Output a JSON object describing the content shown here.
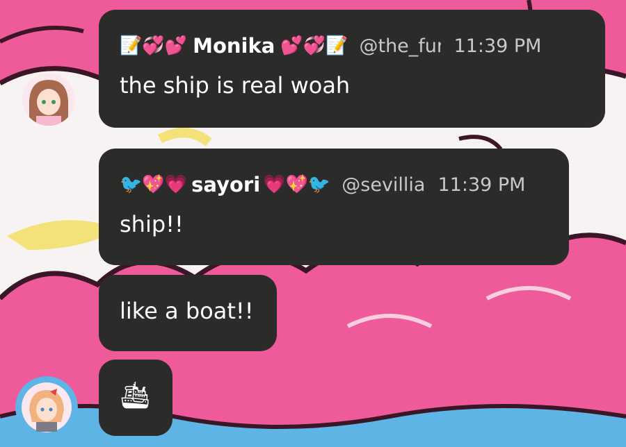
{
  "colors": {
    "bubble": "#2b2b2a",
    "pink": "#ee5a9a",
    "outline": "#3a1626",
    "yellow": "#f3e27a",
    "sky": "#5fb4e6",
    "text": "#ffffff",
    "meta": "#c9c9c9"
  },
  "messages": [
    {
      "author": "Monika",
      "handle": "@the_fun",
      "time": "11:39 PM",
      "emoji_before": "📝💞💕",
      "emoji_after": "💕💞📝",
      "text": "the ship is real woah"
    },
    {
      "author": "sayori",
      "handle": "@sevillia",
      "time": "11:39 PM",
      "emoji_before": "🐦💖💗",
      "emoji_after": "💗💖🐦",
      "text": "ship!!"
    },
    {
      "text": "like a boat!!"
    },
    {
      "text": "🛳"
    }
  ],
  "avatars": [
    {
      "icon": "monika-avatar"
    },
    {
      "icon": "sayori-avatar"
    }
  ]
}
